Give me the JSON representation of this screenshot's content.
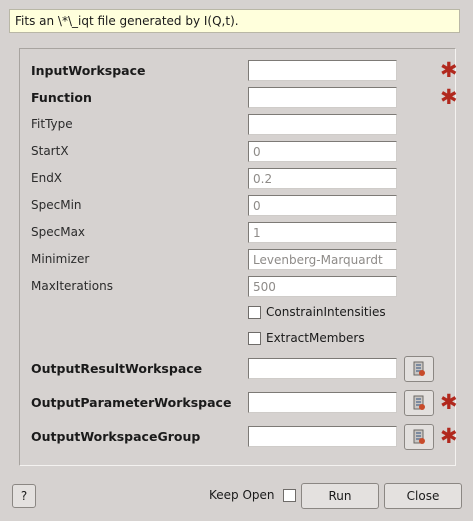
{
  "description": "Fits an \\*\\_iqt file generated by I(Q,t).",
  "properties": [
    {
      "label": "InputWorkspace",
      "required": true,
      "value": "",
      "placeholder": ""
    },
    {
      "label": "Function",
      "required": true,
      "value": "",
      "placeholder": ""
    },
    {
      "label": "FitType",
      "required": false,
      "value": "",
      "placeholder": ""
    },
    {
      "label": "StartX",
      "required": false,
      "value": "",
      "placeholder": "0"
    },
    {
      "label": "EndX",
      "required": false,
      "value": "",
      "placeholder": "0.2"
    },
    {
      "label": "SpecMin",
      "required": false,
      "value": "",
      "placeholder": "0"
    },
    {
      "label": "SpecMax",
      "required": false,
      "value": "",
      "placeholder": "1"
    },
    {
      "label": "Minimizer",
      "required": false,
      "value": "",
      "placeholder": "Levenberg-Marquardt"
    },
    {
      "label": "MaxIterations",
      "required": false,
      "value": "",
      "placeholder": "500"
    }
  ],
  "checkboxes": [
    {
      "label": "ConstrainIntensities",
      "checked": false
    },
    {
      "label": "ExtractMembers",
      "checked": false
    }
  ],
  "outputs": [
    {
      "label": "OutputResultWorkspace",
      "value": "",
      "required": false
    },
    {
      "label": "OutputParameterWorkspace",
      "value": "",
      "required": true
    },
    {
      "label": "OutputWorkspaceGroup",
      "value": "",
      "required": true
    }
  ],
  "required_marker_color": "#b1281d",
  "footer": {
    "help_label": "?",
    "keep_open_label": "Keep Open",
    "keep_open_checked": false,
    "run_label": "Run",
    "close_label": "Close"
  }
}
